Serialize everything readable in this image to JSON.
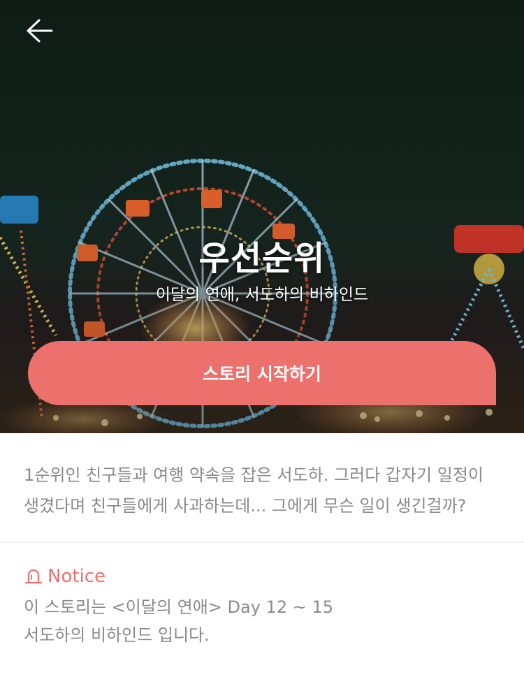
{
  "header": {
    "back_icon": "arrow-left-icon"
  },
  "hero": {
    "title": "우선순위",
    "subtitle": "이달의 연애, 서도하의 비하인드",
    "start_button": "스토리 시작하기",
    "accent_color": "#ec706c"
  },
  "description": "1순위인 친구들과 여행 약속을 잡은 서도하. 그러다 갑자기 일정이 생겼다며 친구들에게 사과하는데... 그에게 무슨 일이 생긴걸까?",
  "notice": {
    "icon": "siren-icon",
    "title": "Notice",
    "line1": "이 스토리는 <이달의 연애> Day 12 ~ 15",
    "line2": "서도하의 비하인드 입니다."
  }
}
